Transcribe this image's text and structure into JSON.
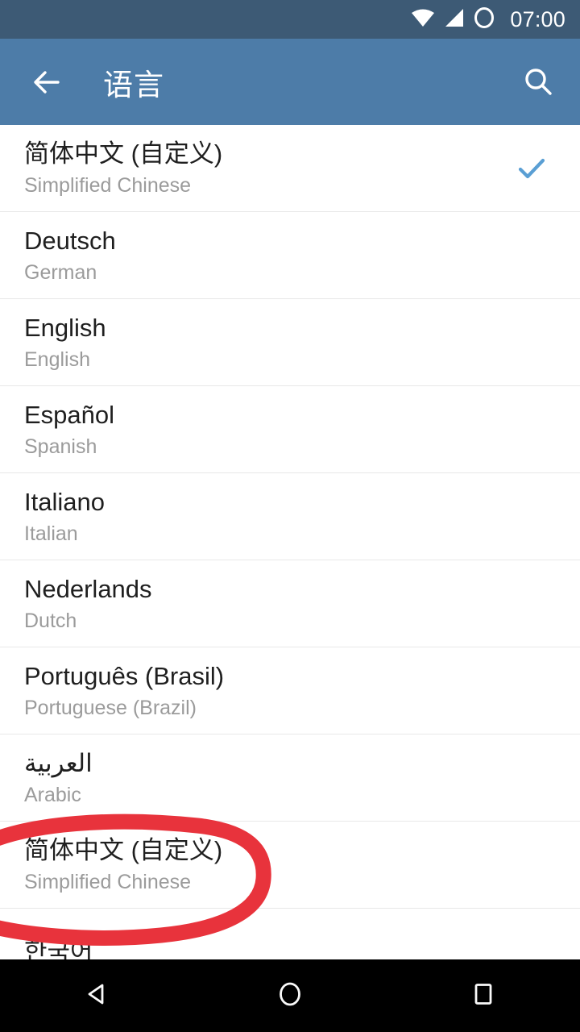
{
  "status_bar": {
    "time": "07:00",
    "icons": [
      "wifi-icon",
      "signal-icon",
      "alarm-circle-icon"
    ],
    "background_color": "#3d5a75"
  },
  "app_bar": {
    "title": "语言",
    "back_icon": "back-arrow-icon",
    "search_icon": "search-icon",
    "background_color": "#4d7ca8"
  },
  "list": {
    "check_color": "#5a9fd4",
    "items": [
      {
        "native": "简体中文 (自定义)",
        "english": "Simplified Chinese",
        "selected": true,
        "rtl": false
      },
      {
        "native": "Deutsch",
        "english": "German",
        "selected": false,
        "rtl": false
      },
      {
        "native": "English",
        "english": "English",
        "selected": false,
        "rtl": false
      },
      {
        "native": "Español",
        "english": "Spanish",
        "selected": false,
        "rtl": false
      },
      {
        "native": "Italiano",
        "english": "Italian",
        "selected": false,
        "rtl": false
      },
      {
        "native": "Nederlands",
        "english": "Dutch",
        "selected": false,
        "rtl": false
      },
      {
        "native": "Português (Brasil)",
        "english": "Portuguese (Brazil)",
        "selected": false,
        "rtl": false
      },
      {
        "native": "العربية",
        "english": "Arabic",
        "selected": false,
        "rtl": true
      },
      {
        "native": "简体中文 (自定义)",
        "english": "Simplified Chinese",
        "selected": false,
        "rtl": false
      },
      {
        "native": "한국어",
        "english": "",
        "selected": false,
        "rtl": false
      }
    ]
  },
  "annotation": {
    "shape": "hand-drawn-ellipse",
    "color": "#e8333c",
    "stroke_width": 19,
    "target_item_index": 8
  },
  "nav_bar": {
    "background_color": "#000000",
    "buttons": [
      {
        "name": "nav-back-button",
        "icon": "triangle-left-icon"
      },
      {
        "name": "nav-home-button",
        "icon": "circle-icon"
      },
      {
        "name": "nav-recents-button",
        "icon": "square-icon"
      }
    ]
  }
}
